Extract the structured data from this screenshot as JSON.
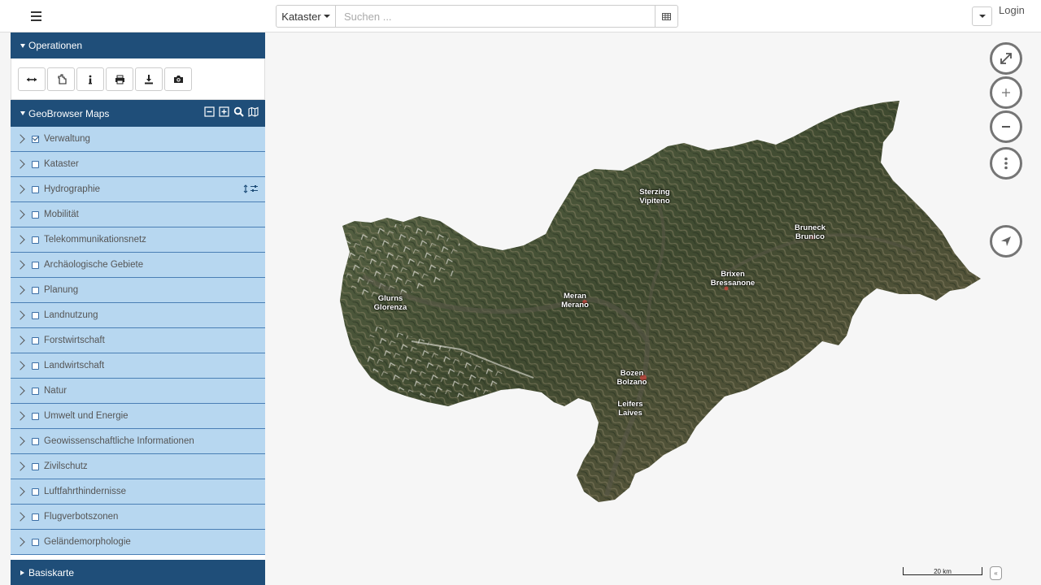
{
  "topbar": {
    "search_type": "Kataster",
    "search_placeholder": "Suchen ...",
    "login_label": "Login"
  },
  "sidebar": {
    "operations_title": "Operationen",
    "operations_tools": [
      "measure-icon",
      "select-icon",
      "info-icon",
      "print-icon",
      "download-icon",
      "camera-icon"
    ],
    "geobrowser_title": "GeoBrowser Maps",
    "layers": [
      {
        "label": "Verwaltung",
        "checked": true
      },
      {
        "label": "Kataster",
        "checked": false
      },
      {
        "label": "Hydrographie",
        "checked": false
      },
      {
        "label": "Mobilität",
        "checked": false
      },
      {
        "label": "Telekommunikationsnetz",
        "checked": false
      },
      {
        "label": "Archäologische Gebiete",
        "checked": false
      },
      {
        "label": "Planung",
        "checked": false
      },
      {
        "label": "Landnutzung",
        "checked": false
      },
      {
        "label": "Forstwirtschaft",
        "checked": false
      },
      {
        "label": "Landwirtschaft",
        "checked": false
      },
      {
        "label": "Natur",
        "checked": false
      },
      {
        "label": "Umwelt und Energie",
        "checked": false
      },
      {
        "label": "Geowissenschaftliche Informationen",
        "checked": false
      },
      {
        "label": "Zivilschutz",
        "checked": false
      },
      {
        "label": "Luftfahrthindernisse",
        "checked": false
      },
      {
        "label": "Flugverbotszonen",
        "checked": false
      },
      {
        "label": "Geländemorphologie",
        "checked": false
      }
    ],
    "basemap_title": "Basiskarte"
  },
  "map": {
    "cities": [
      {
        "line1": "Sterzing",
        "line2": "Vipiteno"
      },
      {
        "line1": "Bruneck",
        "line2": "Brunico"
      },
      {
        "line1": "Brixen",
        "line2": "Bressanone"
      },
      {
        "line1": "Glurns",
        "line2": "Glorenza"
      },
      {
        "line1": "Meran",
        "line2": "Merano"
      },
      {
        "line1": "Bozen",
        "line2": "Bolzano"
      },
      {
        "line1": "Leifers",
        "line2": "Laives"
      }
    ],
    "scale_label": "20 km",
    "attribution_glyph": "«"
  },
  "colors": {
    "panel_header": "#1f4e79",
    "layer_row": "#b7d7f0",
    "terrain_dark": "#3d4a2e",
    "terrain_mid": "#6b6a45"
  }
}
